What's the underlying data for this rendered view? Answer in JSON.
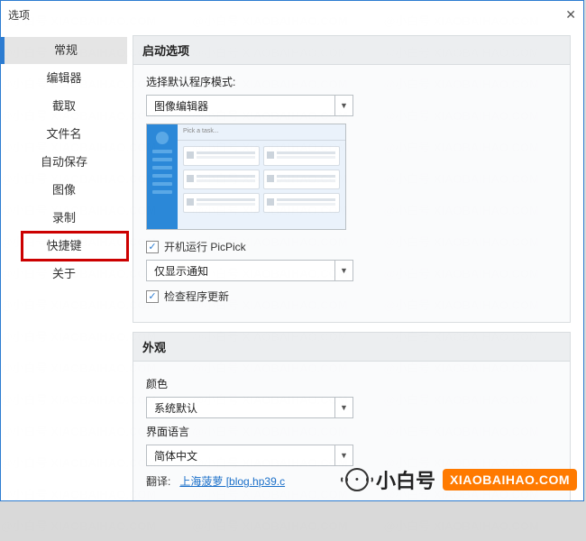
{
  "window": {
    "title": "选项"
  },
  "sidebar": {
    "items": [
      {
        "label": "常规"
      },
      {
        "label": "编辑器"
      },
      {
        "label": "截取"
      },
      {
        "label": "文件名"
      },
      {
        "label": "自动保存"
      },
      {
        "label": "图像"
      },
      {
        "label": "录制"
      },
      {
        "label": "快捷键"
      },
      {
        "label": "关于"
      }
    ]
  },
  "startup": {
    "group_title": "启动选项",
    "mode_label": "选择默认程序模式:",
    "mode_value": "图像编辑器",
    "autostart_label": "开机运行 PicPick",
    "notify_value": "仅显示通知",
    "update_label": "检查程序更新"
  },
  "appearance": {
    "group_title": "外观",
    "color_label": "颜色",
    "color_value": "系统默认",
    "lang_label": "界面语言",
    "lang_value": "简体中文",
    "translate_prefix": "翻译:",
    "translate_link": "上海菠萝 [blog.hp39.c"
  },
  "brand": {
    "cn": "小白号",
    "badge": "XIAOBAIHAO.COM"
  },
  "watermark": "@小白号  XIAOBAIHAO.COM"
}
